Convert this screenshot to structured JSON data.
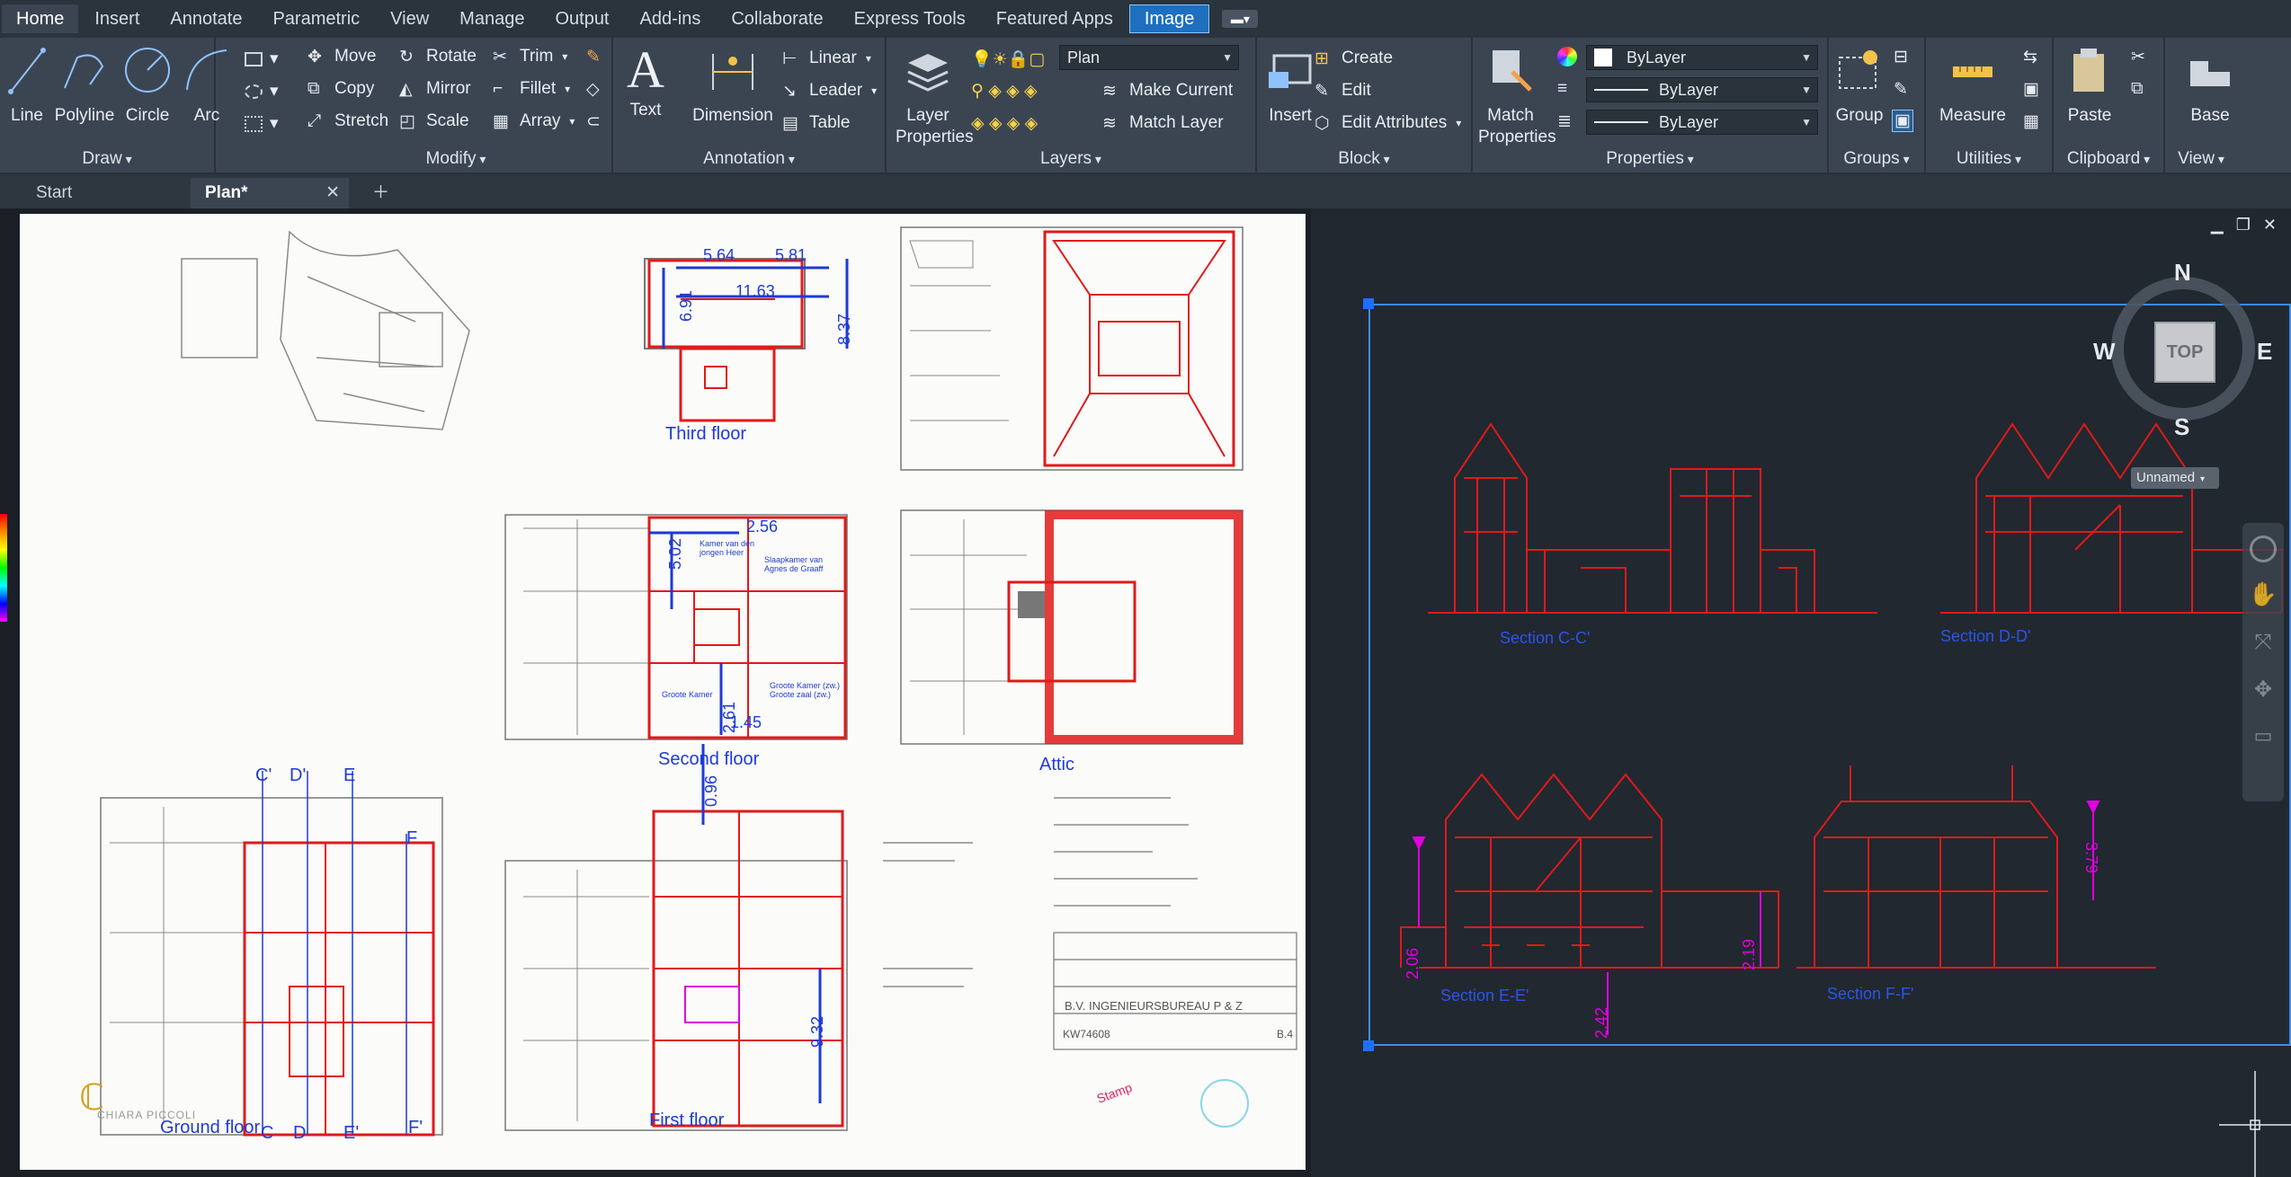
{
  "menu": {
    "tabs": [
      "Home",
      "Insert",
      "Annotate",
      "Parametric",
      "View",
      "Manage",
      "Output",
      "Add-ins",
      "Collaborate",
      "Express Tools",
      "Featured Apps",
      "Image"
    ],
    "active": "Home"
  },
  "ribbon": {
    "draw": {
      "title": "Draw",
      "line": "Line",
      "polyline": "Polyline",
      "circle": "Circle",
      "arc": "Arc"
    },
    "modify": {
      "title": "Modify",
      "move": "Move",
      "rotate": "Rotate",
      "trim": "Trim",
      "copy": "Copy",
      "mirror": "Mirror",
      "fillet": "Fillet",
      "stretch": "Stretch",
      "scale": "Scale",
      "array": "Array"
    },
    "annotation": {
      "title": "Annotation",
      "text": "Text",
      "dimension": "Dimension",
      "linear": "Linear",
      "leader": "Leader",
      "table": "Table"
    },
    "layers": {
      "title": "Layers",
      "layer_properties_1": "Layer",
      "layer_properties_2": "Properties",
      "current_layer": "Plan",
      "make_current": "Make Current",
      "match_layer": "Match Layer"
    },
    "block": {
      "title": "Block",
      "insert": "Insert",
      "create": "Create",
      "edit": "Edit",
      "edit_attributes": "Edit Attributes"
    },
    "properties": {
      "title": "Properties",
      "match_1": "Match",
      "match_2": "Properties",
      "color": "ByLayer",
      "linetype": "ByLayer",
      "lineweight": "ByLayer"
    },
    "groups": {
      "title": "Groups",
      "group": "Group"
    },
    "utilities": {
      "title": "Utilities",
      "measure": "Measure"
    },
    "clipboard": {
      "title": "Clipboard",
      "paste": "Paste"
    },
    "view": {
      "title": "View",
      "base": "Base"
    }
  },
  "doc_tabs": {
    "start": "Start",
    "plan": "Plan*"
  },
  "sheet": {
    "labels": {
      "third": "Third floor",
      "second": "Second floor",
      "attic": "Attic",
      "first": "First floor",
      "ground": "Ground floor"
    },
    "dims": [
      "5.64",
      "5.81",
      "11.63",
      "6.91",
      "8.37",
      "2.56",
      "5.02",
      "2.61",
      "1.45",
      "0.96",
      "9.32"
    ],
    "section_marks_top": [
      "C'",
      "D'",
      "E"
    ],
    "section_marks_bottom": [
      "C",
      "D",
      "E'"
    ],
    "f_top": "F",
    "f_bottom": "F'",
    "rooms": [
      "Kamer van den jongen Heer",
      "Slaapkamer van Agnes de Graaff",
      "Groote Kamer",
      "Groote Kamer (zw.) Groote zaal (zw.)"
    ],
    "watermark": "CHIARA PICCOLI",
    "title_block": {
      "firm": "B.V. INGENIEURSBUREAU  P & Z",
      "number": "KW74608",
      "sheet": "B.4"
    }
  },
  "viewport": {
    "sections": [
      "Section C-C'",
      "Section D-D'",
      "Section E-E'",
      "Section F-F'"
    ],
    "dims": [
      "2.06",
      "2.19",
      "2.42",
      "3.79"
    ],
    "viewcube": {
      "n": "N",
      "s": "S",
      "e": "E",
      "w": "W",
      "face": "TOP"
    },
    "ucs_name": "Unnamed"
  },
  "colors": {
    "accent": "#1e6fbf",
    "red": "#e01a1a",
    "blue": "#1f3ad6",
    "magenta": "#e000e0"
  }
}
